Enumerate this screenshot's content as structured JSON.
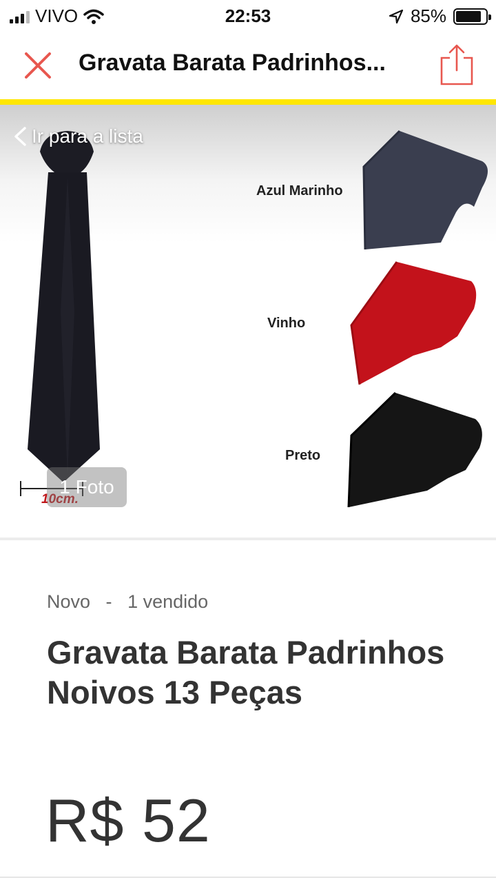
{
  "status_bar": {
    "carrier": "VIVO",
    "time": "22:53",
    "battery": "85%",
    "battery_level": 0.85
  },
  "header": {
    "title": "Gravata Barata Padrinhos..."
  },
  "gallery": {
    "back_label": "Ir para a lista",
    "photo_count": "1 Foto",
    "colors": [
      "Azul Marinho",
      "Vinho",
      "Preto"
    ],
    "measure_label": "10cm."
  },
  "product": {
    "condition": "Novo",
    "separator": "-",
    "sold": "1 vendido",
    "title": "Gravata Barata Padrinhos Noivos 13 Peças",
    "price": "R$ 52"
  },
  "colors": {
    "close_icon": "#e8574f",
    "share_icon": "#e8574f",
    "accent": "#ffe600",
    "navy_tie": "#3a3e4f",
    "wine_tie": "#c3121b",
    "black_tie": "#151515"
  }
}
